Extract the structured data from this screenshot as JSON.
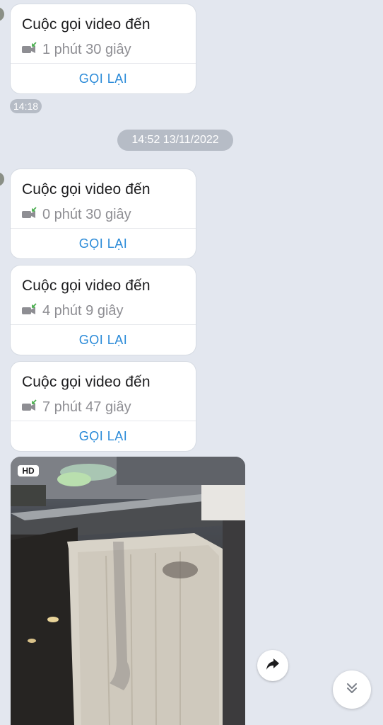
{
  "messages_top": [
    {
      "title": "Cuộc gọi video đến",
      "duration": "1 phút 30 giây",
      "callback_label": "GỌI LẠI",
      "icon": "video-call-incoming-icon"
    }
  ],
  "time_label": "14:18",
  "date_separator": "14:52 13/11/2022",
  "messages_bottom": [
    {
      "title": "Cuộc gọi video đến",
      "duration": "0 phút 30 giây",
      "callback_label": "GỌI LẠI",
      "icon": "video-call-incoming-icon"
    },
    {
      "title": "Cuộc gọi video đến",
      "duration": "4 phút 9 giây",
      "callback_label": "GỌI LẠI",
      "icon": "video-call-incoming-icon"
    },
    {
      "title": "Cuộc gọi video đến",
      "duration": "7 phút 47 giây",
      "callback_label": "GỌI LẠI",
      "icon": "video-call-incoming-icon"
    }
  ],
  "photo": {
    "badge": "HD"
  },
  "buttons": {
    "forward_icon": "share-arrow-icon",
    "scroll_down_icon": "double-chevron-down-icon"
  },
  "colors": {
    "background": "#e3e7ef",
    "accent": "#2a8ad8",
    "incoming_arrow": "#4caf50",
    "pill": "#b6bcc6"
  }
}
